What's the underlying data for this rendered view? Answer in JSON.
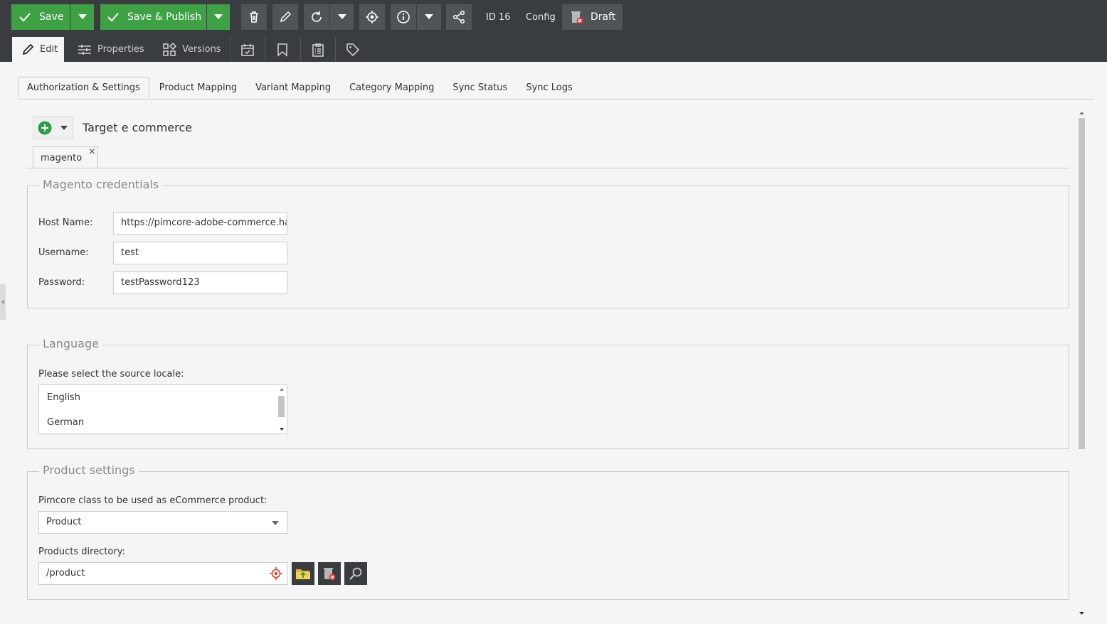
{
  "toolbar": {
    "save_label": "Save",
    "save_publish_label": "Save & Publish",
    "id_label": "ID 16",
    "class_label": "Config",
    "draft_label": "Draft"
  },
  "editor_tabs": [
    {
      "label": "Edit",
      "icon": "pencil-icon",
      "active": true
    },
    {
      "label": "Properties",
      "icon": "sliders-icon"
    },
    {
      "label": "Versions",
      "icon": "versions-icon"
    },
    {
      "label": "",
      "icon": "calendar-check-icon"
    },
    {
      "label": "",
      "icon": "bookmark-icon"
    },
    {
      "label": "",
      "icon": "clipboard-list-icon"
    },
    {
      "label": "",
      "icon": "tag-icon"
    }
  ],
  "main_tabs": [
    "Authorization & Settings",
    "Product Mapping",
    "Variant Mapping",
    "Category Mapping",
    "Sync Status",
    "Sync Logs"
  ],
  "target": {
    "title": "Target e commerce",
    "tab_label": "magento",
    "close_glyph": "×"
  },
  "credentials": {
    "legend": "Magento credentials",
    "host_label": "Host Name:",
    "host_value": "https://pimcore-adobe-commerce.ha",
    "username_label": "Username:",
    "username_value": "test",
    "password_label": "Password:",
    "password_value": "testPassword123"
  },
  "language": {
    "legend": "Language",
    "prompt": "Please select the source locale:",
    "options": [
      "English",
      "German"
    ]
  },
  "product_settings": {
    "legend": "Product settings",
    "class_label": "Pimcore class to be used as eCommerce product:",
    "class_value": "Product",
    "dir_label": "Products directory:",
    "dir_value": "/product"
  },
  "colors": {
    "toolbar_bg": "#3a3d40",
    "green": "#3ea244",
    "tool_btn": "#505458",
    "content_bg": "#f5f5f5"
  }
}
